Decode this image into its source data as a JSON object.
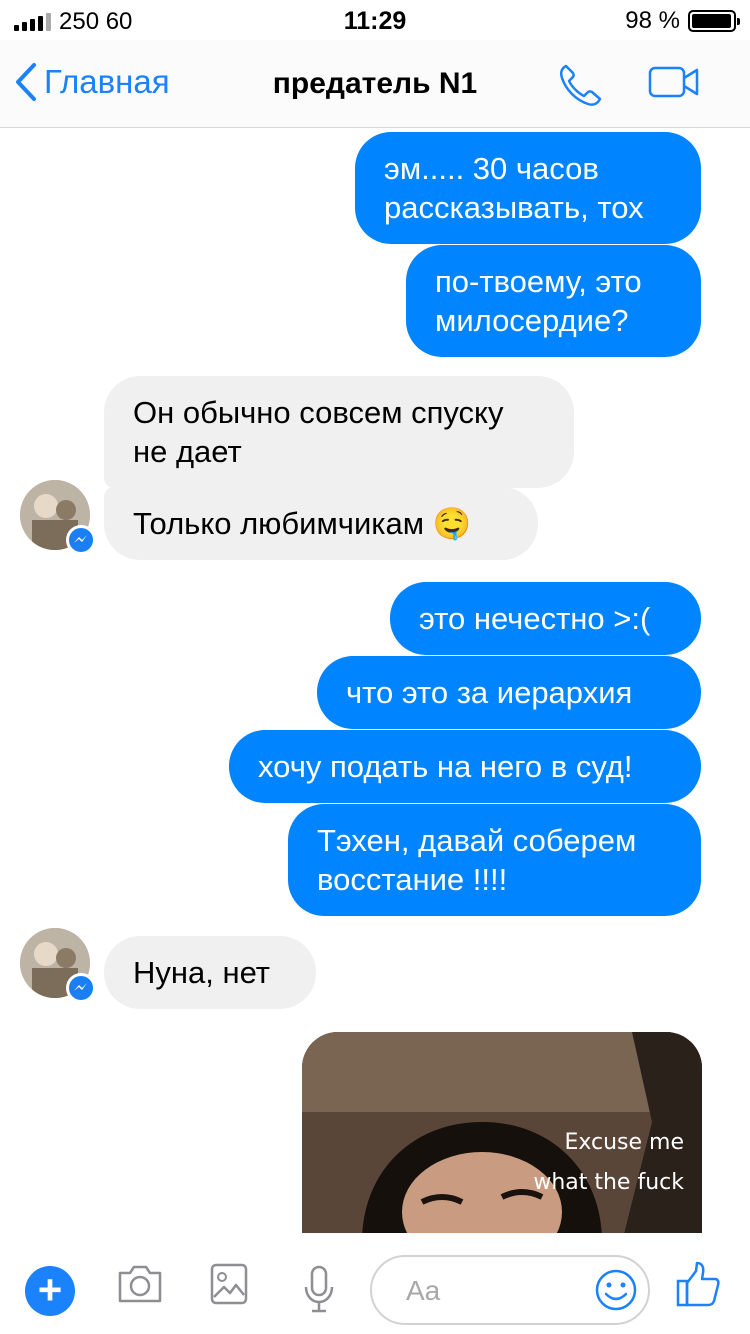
{
  "status_bar": {
    "carrier": "250 60",
    "time": "11:29",
    "battery_percent": "98 %",
    "battery_level": 0.98
  },
  "nav": {
    "back_label": "Главная",
    "title": "предатель N1",
    "accent_color": "#1a82fb"
  },
  "messages": [
    {
      "direction": "outgoing",
      "lines": [
        "эм..... 30 часов",
        "рассказывать, тох"
      ]
    },
    {
      "direction": "outgoing",
      "lines": [
        "по-твоему, это",
        "милосердие?"
      ]
    },
    {
      "direction": "incoming",
      "lines": [
        "Он обычно совсем спуску",
        "не дает"
      ]
    },
    {
      "direction": "incoming",
      "lines": [
        "Только любимчикам 🤤"
      ]
    },
    {
      "direction": "outgoing",
      "lines": [
        "это нечестно >:("
      ]
    },
    {
      "direction": "outgoing",
      "lines": [
        "что это за иерархия"
      ]
    },
    {
      "direction": "outgoing",
      "lines": [
        "хочу подать на него в суд!"
      ]
    },
    {
      "direction": "outgoing",
      "lines": [
        "Тэхен, давай соберем",
        "восстание !!!!"
      ]
    },
    {
      "direction": "incoming",
      "lines": [
        "Нуна, нет"
      ]
    }
  ],
  "media_message": {
    "direction": "outgoing",
    "caption_lines": [
      "Excuse me",
      "what the fuck"
    ]
  },
  "composer": {
    "placeholder": "Aa",
    "icons": [
      "plus-icon",
      "camera-icon",
      "image-icon",
      "microphone-icon",
      "emoji-icon",
      "thumbs-up-icon"
    ]
  },
  "colors": {
    "outgoing_bubble": "#0084ff",
    "incoming_bubble": "#f1f0f0"
  }
}
